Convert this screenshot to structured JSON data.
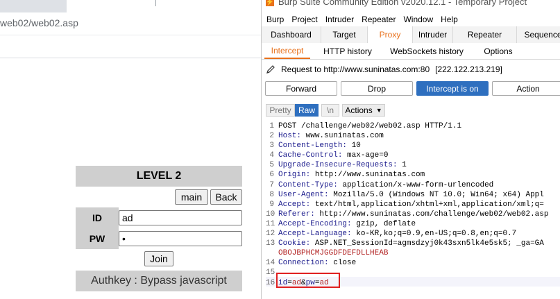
{
  "browser": {
    "url": "web02/web02.asp",
    "level_title": "LEVEL 2",
    "main_label": "main",
    "back_label": "Back",
    "id_label": "ID",
    "id_value": "ad",
    "pw_label": "PW",
    "pw_value": "•",
    "join_label": "Join",
    "authkey_text": "Authkey : Bypass javascript"
  },
  "burp": {
    "title": "Burp Suite Community Edition v2020.12.1 - Temporary Project",
    "logo": "⚡",
    "menu": [
      "Burp",
      "Project",
      "Intruder",
      "Repeater",
      "Window",
      "Help"
    ],
    "main_tabs": [
      "Dashboard",
      "Target",
      "Proxy",
      "Intruder",
      "Repeater",
      "Sequencer"
    ],
    "sub_tabs": [
      "Intercept",
      "HTTP history",
      "WebSockets history",
      "Options"
    ],
    "request_to": "Request to http://www.suninatas.com:80",
    "request_ip": "[222.122.213.219]",
    "buttons": {
      "forward": "Forward",
      "drop": "Drop",
      "intercept": "Intercept is on",
      "action": "Action"
    },
    "view": {
      "pretty": "Pretty",
      "raw": "Raw",
      "newline": "\\n",
      "actions": "Actions"
    },
    "request_lines": [
      {
        "n": "1",
        "k": "",
        "v": "POST /challenge/web02/web02.asp HTTP/1.1"
      },
      {
        "n": "2",
        "k": "Host:",
        "v": " www.suninatas.com"
      },
      {
        "n": "3",
        "k": "Content-Length:",
        "v": " 10"
      },
      {
        "n": "4",
        "k": "Cache-Control:",
        "v": " max-age=0"
      },
      {
        "n": "5",
        "k": "Upgrade-Insecure-Requests:",
        "v": " 1"
      },
      {
        "n": "6",
        "k": "Origin:",
        "v": " http://www.suninatas.com"
      },
      {
        "n": "7",
        "k": "Content-Type:",
        "v": " application/x-www-form-urlencoded"
      },
      {
        "n": "8",
        "k": "User-Agent:",
        "v": " Mozilla/5.0 (Windows NT 10.0; Win64; x64) Appl"
      },
      {
        "n": "9",
        "k": "Accept:",
        "v": " text/html,application/xhtml+xml,application/xml;q="
      },
      {
        "n": "10",
        "k": "Referer:",
        "v": " http://www.suninatas.com/challenge/web02/web02.asp"
      },
      {
        "n": "11",
        "k": "Accept-Encoding:",
        "v": " gzip, deflate"
      },
      {
        "n": "12",
        "k": "Accept-Language:",
        "v": " ko-KR,ko;q=0.9,en-US;q=0.8,en;q=0.7"
      },
      {
        "n": "13",
        "k": "Cookie:",
        "v": " ASP.NET_SessionId=agmsdzyj0k43sxn5lk4e5sk5; _ga=GA"
      },
      {
        "n": "",
        "k": "",
        "v": "OBOJBPHCMJGGDFDEFDLLHEAB"
      },
      {
        "n": "14",
        "k": "Connection:",
        "v": " close"
      },
      {
        "n": "15",
        "k": "",
        "v": ""
      },
      {
        "n": "16",
        "k": "",
        "v": ""
      }
    ],
    "body": {
      "id_key": "id",
      "id_eq": "=",
      "id_val": "ad",
      "amp": "&",
      "pw_key": "pw",
      "pw_eq": "=",
      "pw_val": "ad"
    }
  }
}
